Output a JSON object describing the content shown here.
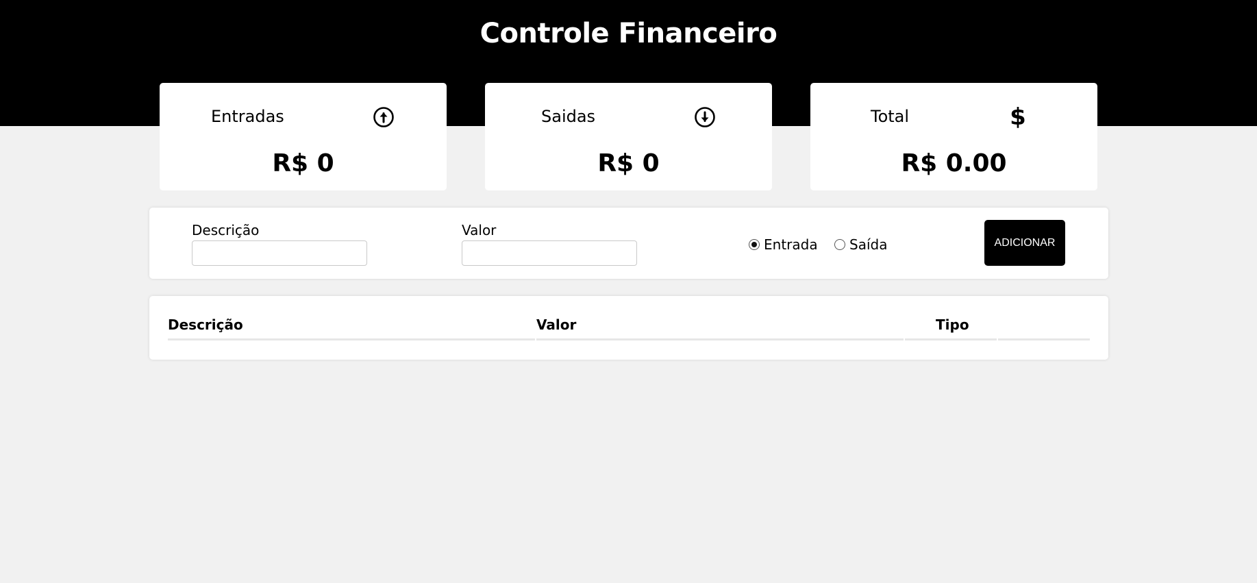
{
  "header": {
    "title": "Controle Financeiro"
  },
  "cards": [
    {
      "title": "Entradas",
      "icon": "arrow-up-circle-icon",
      "value": "R$ 0"
    },
    {
      "title": "Saidas",
      "icon": "arrow-down-circle-icon",
      "value": "R$ 0"
    },
    {
      "title": "Total",
      "icon": "dollar-icon",
      "icon_glyph": "$",
      "value": "R$ 0.00"
    }
  ],
  "form": {
    "description_label": "Descrição",
    "description_value": "",
    "amount_label": "Valor",
    "amount_value": "",
    "radio_in_label": "Entrada",
    "radio_in_checked": true,
    "radio_out_label": "Saída",
    "radio_out_checked": false,
    "add_button_label": "ADICIONAR"
  },
  "table": {
    "columns": [
      "Descrição",
      "Valor",
      "Tipo",
      ""
    ],
    "rows": []
  },
  "colors": {
    "header_bg": "#000000",
    "page_bg": "#f1f1f1",
    "card_bg": "#ffffff",
    "button_bg": "#000000"
  }
}
